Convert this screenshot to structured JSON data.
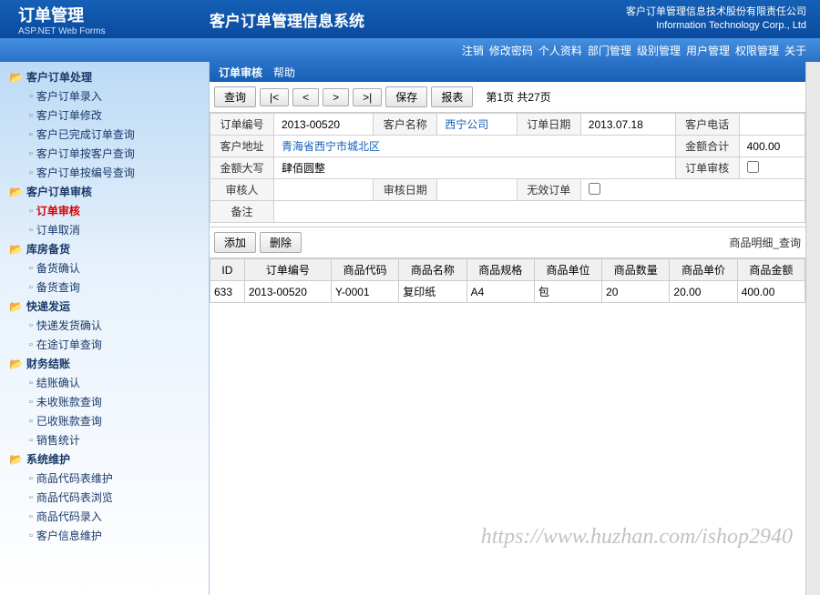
{
  "header": {
    "logo_title": "订单管理",
    "logo_sub": "ASP.NET Web Forms",
    "sys_title": "客户订单管理信息系统",
    "corp_cn": "客户订单管理信息技术股份有限责任公司",
    "corp_en": "Information Technology Corp., Ltd"
  },
  "menubar": [
    "注销",
    "修改密码",
    "个人资料",
    "部门管理",
    "级别管理",
    "用户管理",
    "权限管理",
    "关于"
  ],
  "nav": [
    {
      "label": "客户订单处理",
      "items": [
        "客户订单录入",
        "客户订单修改",
        "客户已完成订单查询",
        "客户订单按客户查询",
        "客户订单按编号查询"
      ]
    },
    {
      "label": "客户订单审核",
      "items": [
        "订单审核",
        "订单取消"
      ],
      "activeIndex": 0
    },
    {
      "label": "库房备货",
      "items": [
        "备货确认",
        "备货查询"
      ]
    },
    {
      "label": "快递发运",
      "items": [
        "快递发货确认",
        "在途订单查询"
      ]
    },
    {
      "label": "财务结账",
      "items": [
        "结账确认",
        "未收账款查询",
        "已收账款查询",
        "销售统计"
      ]
    },
    {
      "label": "系统维护",
      "items": [
        "商品代码表维护",
        "商品代码表浏览",
        "商品代码录入",
        "客户信息维护"
      ]
    }
  ],
  "breadcrumb": {
    "title": "订单审核",
    "help": "帮助"
  },
  "toolbar": {
    "query": "查询",
    "first": "|<",
    "prev": "<",
    "next": ">",
    "last": ">|",
    "save": "保存",
    "report": "报表",
    "pager": "第1页 共27页"
  },
  "form": {
    "labels": {
      "order_no": "订单编号",
      "cust_name": "客户名称",
      "order_date": "订单日期",
      "cust_phone": "客户电话",
      "cust_addr": "客户地址",
      "amount_total": "金额合计",
      "amount_cn": "金额大写",
      "order_audit": "订单审核",
      "auditor": "审核人",
      "audit_date": "审核日期",
      "invalid": "无效订单",
      "remark": "备注"
    },
    "values": {
      "order_no": "2013-00520",
      "cust_name": "西宁公司",
      "order_date": "2013.07.18",
      "cust_phone": "",
      "cust_addr": "青海省西宁市城北区",
      "amount_total": "400.00",
      "amount_cn": "肆佰圆整",
      "auditor": "",
      "audit_date": "",
      "remark": ""
    }
  },
  "sub_toolbar": {
    "add": "添加",
    "delete": "删除",
    "right": "商品明细_查询"
  },
  "grid": {
    "headers": [
      "ID",
      "订单编号",
      "商品代码",
      "商品名称",
      "商品规格",
      "商品单位",
      "商品数量",
      "商品单价",
      "商品金额"
    ],
    "rows": [
      [
        "633",
        "2013-00520",
        "Y-0001",
        "复印纸",
        "A4",
        "包",
        "20",
        "20.00",
        "400.00"
      ]
    ]
  },
  "watermark": "https://www.huzhan.com/ishop2940"
}
